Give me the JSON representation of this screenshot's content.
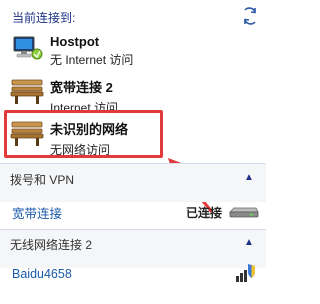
{
  "header": {
    "title": "当前连接到:"
  },
  "networks": [
    {
      "name": "Hostpot",
      "status": "无 Internet 访问"
    },
    {
      "name": "宽带连接 2",
      "status": "Internet 访问"
    },
    {
      "name": "未识别的网络",
      "status": "无网络访问"
    }
  ],
  "dialup": {
    "title": "拨号和 VPN",
    "item": {
      "name": "宽带连接",
      "status": "已连接"
    }
  },
  "wireless": {
    "title": "无线网络连接 2",
    "item": {
      "name": "Baidu4658"
    }
  },
  "colors": {
    "highlight": "#e03a3a",
    "link": "#1a5aa8",
    "header": "#1e3287"
  }
}
